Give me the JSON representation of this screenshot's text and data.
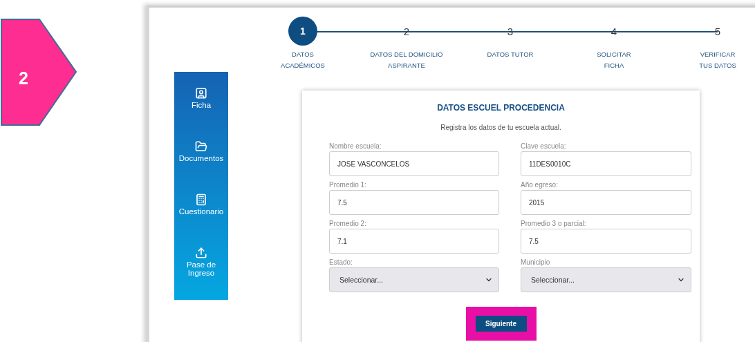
{
  "badge": {
    "label": "2"
  },
  "steps": [
    {
      "number": "1",
      "label": [
        "DATOS",
        "ACADÉMICOS"
      ],
      "selected": true
    },
    {
      "number": "2",
      "label": [
        "DATOS DEL DOMICILIO",
        "ASPIRANTE"
      ],
      "selected": false
    },
    {
      "number": "3",
      "label": [
        "DATOS TUTOR"
      ],
      "selected": false
    },
    {
      "number": "4",
      "label": [
        "SOLICITAR",
        "FICHA"
      ],
      "selected": false
    },
    {
      "number": "5",
      "label": [
        "VERIFICAR",
        "TUS DATOS"
      ],
      "selected": false
    }
  ],
  "sidebar": {
    "items": [
      {
        "kind": "ficha",
        "label": [
          "Ficha"
        ]
      },
      {
        "kind": "documentos",
        "label": [
          "Documentos"
        ]
      },
      {
        "kind": "cuestionario",
        "label": [
          "Cuestionario"
        ]
      },
      {
        "kind": "pase",
        "label": [
          "Pase de",
          "Ingreso"
        ]
      }
    ]
  },
  "card": {
    "title": "DATOS ESCUEL PROCEDENCIA",
    "subtitle": "Registra los datos de tu escuela actual.",
    "fields": [
      {
        "kind": "input",
        "label": "Nombre escuela:",
        "value": "JOSE VASCONCELOS"
      },
      {
        "kind": "input",
        "label": "Clave escuela:",
        "value": "11DES0010C"
      },
      {
        "kind": "input",
        "label": "Promedio 1:",
        "value": "7.5"
      },
      {
        "kind": "input",
        "label": "Año egreso:",
        "value": "2015"
      },
      {
        "kind": "input",
        "label": "Promedio 2:",
        "value": "7.1"
      },
      {
        "kind": "input",
        "label": "Promedio 3 o parcial:",
        "value": "7.5"
      },
      {
        "kind": "select",
        "label": "Estado:",
        "value": "Seleccionar..."
      },
      {
        "kind": "select",
        "label": "Municipio",
        "value": "Seleccionar..."
      }
    ],
    "button": {
      "label": "Siguiente",
      "highlighted": true
    }
  }
}
